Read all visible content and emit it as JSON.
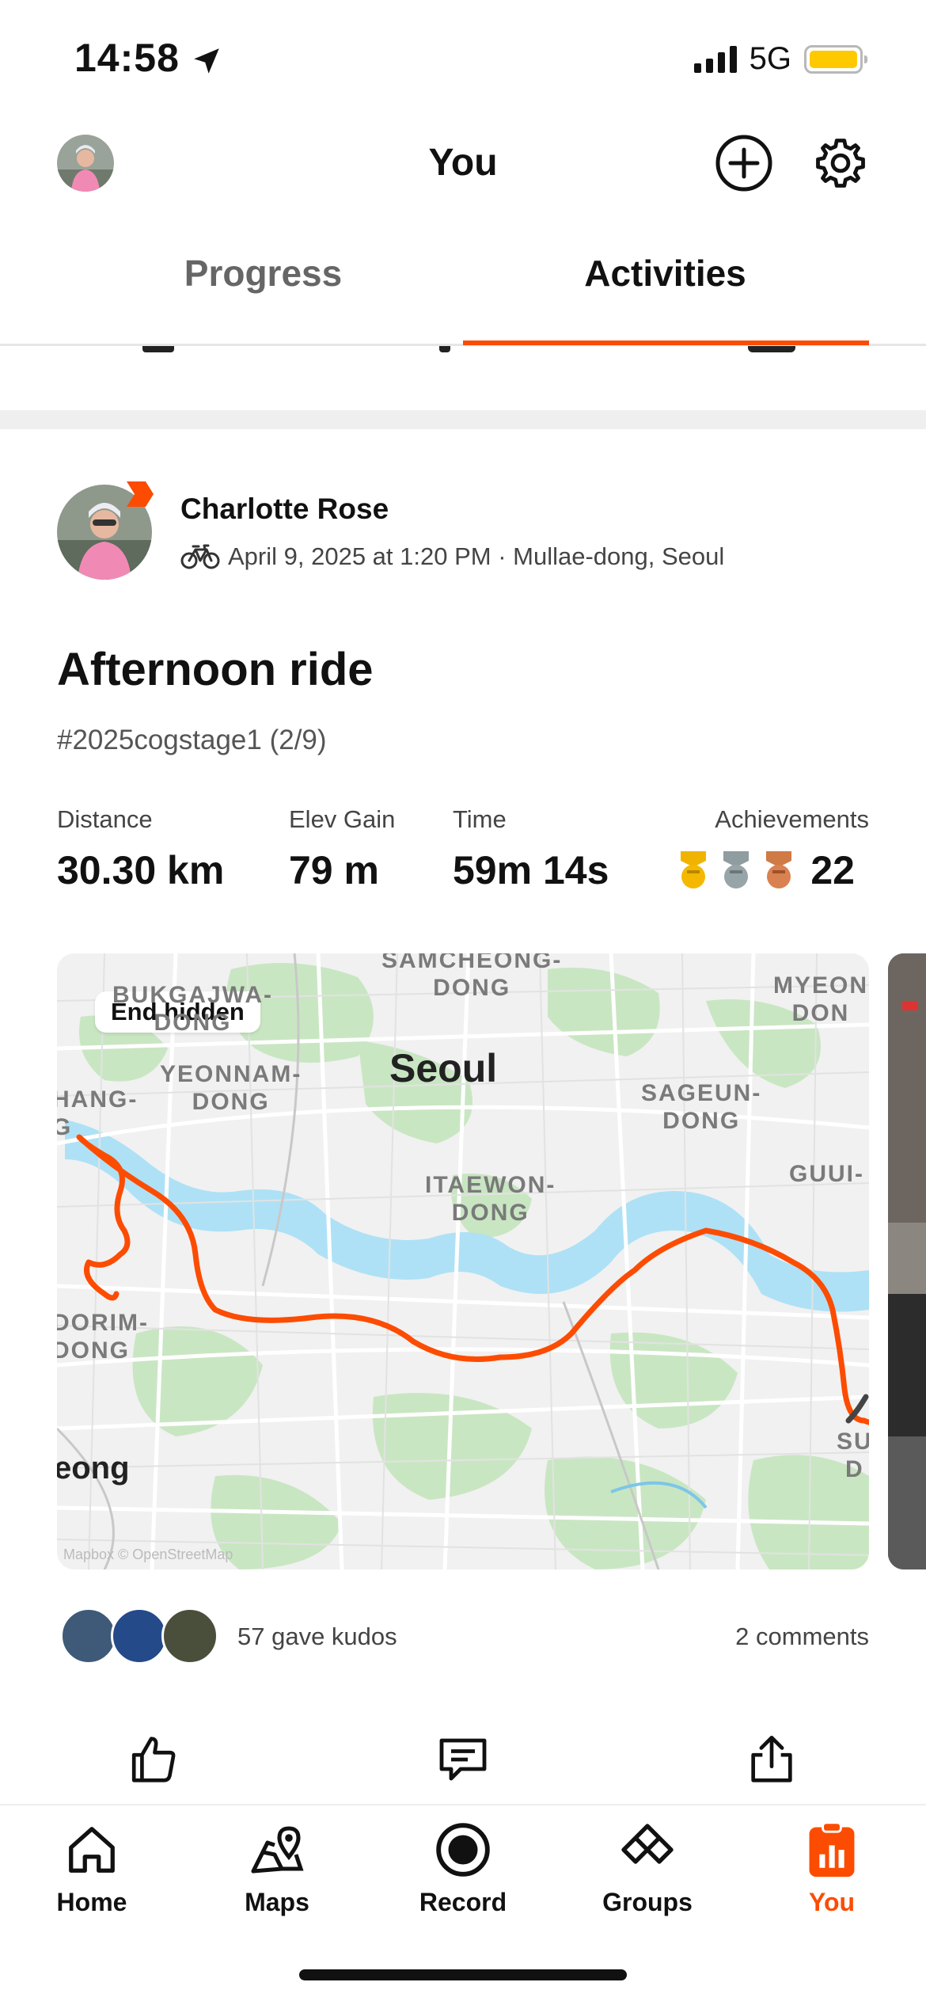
{
  "status_bar": {
    "time": "14:58",
    "network": "5G"
  },
  "header": {
    "title": "You"
  },
  "tabs": [
    {
      "label": "Progress",
      "active": false
    },
    {
      "label": "Activities",
      "active": true
    }
  ],
  "activity": {
    "athlete_name": "Charlotte Rose",
    "meta": "April 9, 2025 at 1:20 PM · Mullae-dong, Seoul",
    "title": "Afternoon ride",
    "description": "#2025cogstage1 (2/9)",
    "stats": {
      "distance": {
        "label": "Distance",
        "value": "30.30 km"
      },
      "elev_gain": {
        "label": "Elev Gain",
        "value": "79 m"
      },
      "time": {
        "label": "Time",
        "value": "59m 14s"
      },
      "achievements": {
        "label": "Achievements",
        "value": "22"
      }
    },
    "map": {
      "badge": "End hidden",
      "labels": {
        "samcheong": "SAMCHEONG-\nDONG",
        "bukgajwa": "BUKGAJWA-\nDONG",
        "myeon": "MYEON\nDON",
        "yeonnam": "YEONNAM-\nDONG",
        "city": "Seoul",
        "hang": "HANG-\nG",
        "sageun": "SAGEUN-\nDONG",
        "guui": "GUUI-",
        "itaewon": "ITAEWON-\nDONG",
        "dorim": "DORIM-\nDONG",
        "su": "SU\nD",
        "yeong": "eong"
      },
      "attribution": "Mapbox © OpenStreetMap"
    },
    "kudos": "57 gave kudos",
    "comments": "2 comments"
  },
  "nav": [
    {
      "label": "Home",
      "icon": "home-icon",
      "active": false
    },
    {
      "label": "Maps",
      "icon": "maps-icon",
      "active": false
    },
    {
      "label": "Record",
      "icon": "record-icon",
      "active": false
    },
    {
      "label": "Groups",
      "icon": "groups-icon",
      "active": false
    },
    {
      "label": "You",
      "icon": "you-icon",
      "active": true
    }
  ],
  "colors": {
    "accent": "#fc4c02",
    "route": "#fc4c02",
    "water": "#aee1f5",
    "park": "#c9e6c2"
  }
}
